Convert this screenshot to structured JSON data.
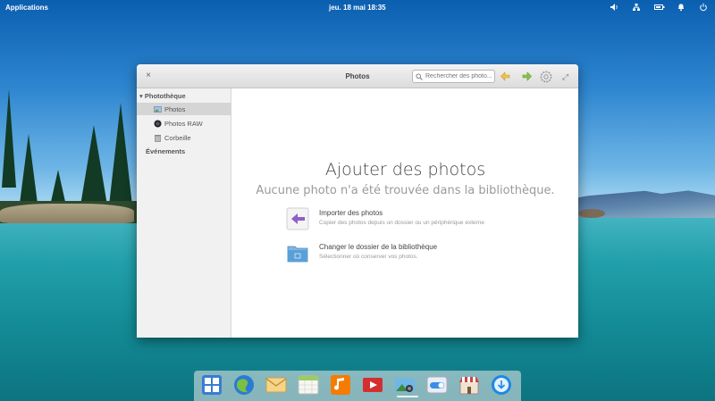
{
  "top_panel": {
    "applications": "Applications",
    "clock": "jeu. 18 mai    18:35",
    "indicators": [
      "volume-icon",
      "network-icon",
      "battery-icon",
      "notifications-icon",
      "power-icon"
    ]
  },
  "window": {
    "title": "Photos",
    "close_label": "×",
    "search": {
      "placeholder": "Rechercher des photo..."
    },
    "toolbar_icons": [
      "rotate-left-icon",
      "rotate-right-icon",
      "settings-icon",
      "fullscreen-icon"
    ]
  },
  "sidebar": {
    "library_header": "Photothèque",
    "items": [
      {
        "label": "Photos",
        "icon": "photos-icon",
        "active": true
      },
      {
        "label": "Photos RAW",
        "icon": "raw-photos-icon",
        "active": false
      },
      {
        "label": "Corbeille",
        "icon": "trash-icon",
        "active": false
      }
    ],
    "events_header": "Événements"
  },
  "main": {
    "title": "Ajouter des photos",
    "subtitle": "Aucune photo n'a été trouvée dans la bibliothèque.",
    "actions": [
      {
        "label": "Importer des photos",
        "description": "Copier des photos depuis un dossier ou un périphérique externe",
        "icon": "import-icon"
      },
      {
        "label": "Changer le dossier de la bibliothèque",
        "description": "Sélectionner où conserver vos photos.",
        "icon": "folder-icon"
      }
    ]
  },
  "dock": {
    "items": [
      "multitasking-view-icon",
      "web-browser-icon",
      "mail-icon",
      "calendar-icon",
      "music-icon",
      "videos-icon",
      "photos-icon",
      "switchboard-icon",
      "appcenter-icon",
      "system-update-icon"
    ]
  },
  "colors": {
    "accent_purple": "#8e5fc7",
    "folder_blue": "#5aa0d8",
    "arrow_yellow": "#f2c14e",
    "arrow_green": "#8bc34a"
  }
}
